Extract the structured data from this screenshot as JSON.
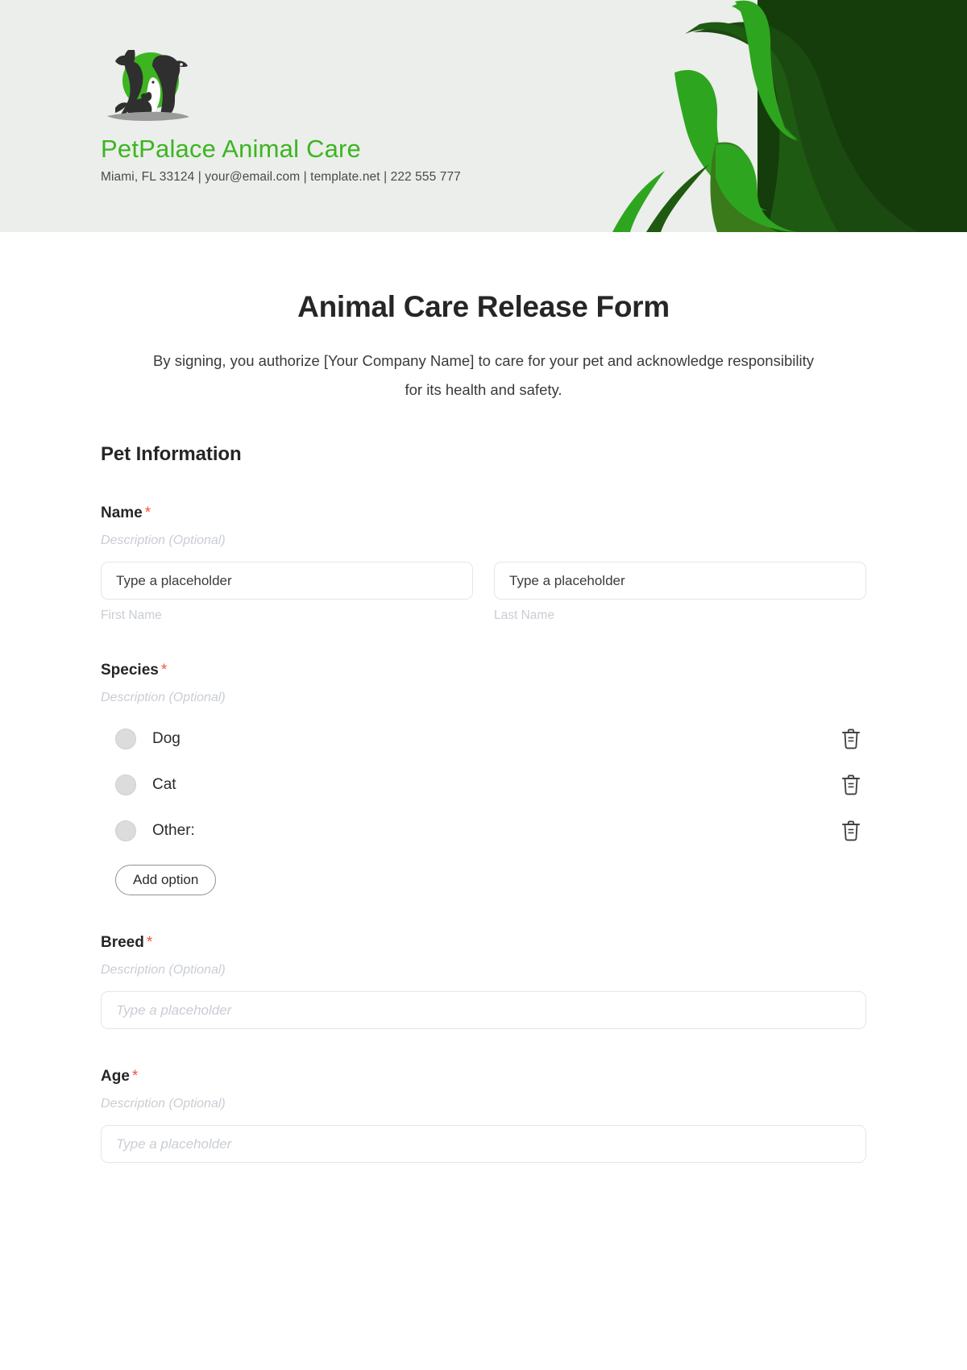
{
  "header": {
    "logo_icon": "pet-palace-logo-dog-cat-rabbit",
    "brand_name": "PetPalace Animal Care",
    "contact_line": "Miami, FL 33124 | your@email.com | template.net | 222 555 777",
    "background_color": "#ebeeea",
    "brand_green": "#3cb521",
    "accent_dark_green": "#153d0c",
    "decoration_icon": "leaf-swirl-decoration"
  },
  "form": {
    "title": "Animal Care Release Form",
    "subtitle": "By signing, you authorize [Your Company Name] to care for your pet and acknowledge responsibility for its health and safety.",
    "section_heading": "Pet Information",
    "required_marker": "*",
    "required_color": "#f2543d",
    "description_placeholder": "Description (Optional)"
  },
  "fields": {
    "name": {
      "label": "Name",
      "required": true,
      "description": "Description (Optional)",
      "first": {
        "placeholder": "Type a placeholder",
        "sub_label": "First Name"
      },
      "last": {
        "placeholder": "Type a placeholder",
        "sub_label": "Last Name"
      }
    },
    "species": {
      "label": "Species",
      "required": true,
      "description": "Description (Optional)",
      "options": [
        {
          "label": "Dog",
          "selected": false,
          "delete_icon": "trash-icon"
        },
        {
          "label": "Cat",
          "selected": false,
          "delete_icon": "trash-icon"
        },
        {
          "label": "Other:",
          "selected": false,
          "delete_icon": "trash-icon"
        }
      ],
      "add_option_label": "Add option"
    },
    "breed": {
      "label": "Breed",
      "required": true,
      "description": "Description (Optional)",
      "placeholder": "Type a placeholder"
    },
    "age": {
      "label": "Age",
      "required": true,
      "description": "Description (Optional)",
      "placeholder": "Type a placeholder"
    }
  }
}
